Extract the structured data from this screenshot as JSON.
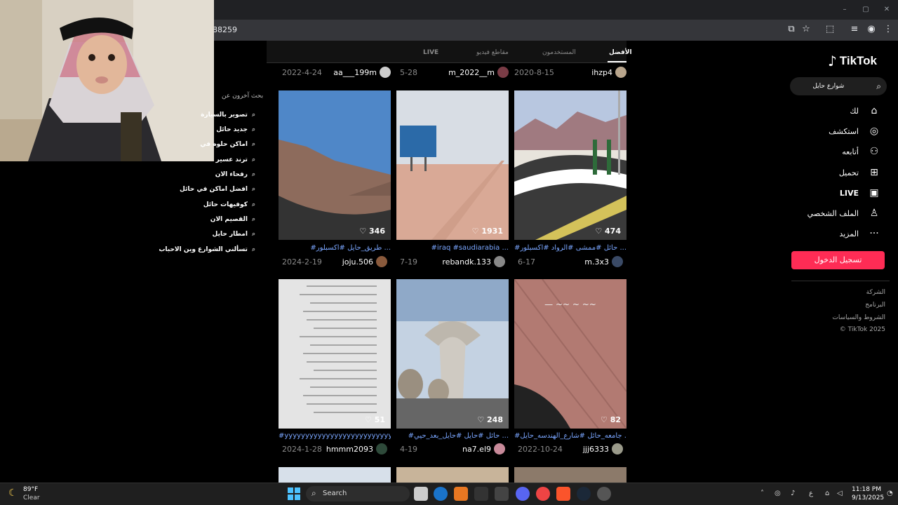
{
  "browser": {
    "url": "488259",
    "window_controls": {
      "minimize": "–",
      "maximize": "▢",
      "close": "✕"
    }
  },
  "tiktok": {
    "logo": "TikTok",
    "search": {
      "value": "شوارع حايل"
    },
    "nav": [
      {
        "label": "لك",
        "icon": "home-icon"
      },
      {
        "label": "استكشف",
        "icon": "compass-icon"
      },
      {
        "label": "أتابعه",
        "icon": "following-icon"
      },
      {
        "label": "تحميل",
        "icon": "upload-icon"
      },
      {
        "label": "LIVE",
        "icon": "live-icon"
      },
      {
        "label": "الملف الشخصي",
        "icon": "profile-icon"
      },
      {
        "label": "المزيد",
        "icon": "more-icon"
      }
    ],
    "login_button": "تسجيل الدخول",
    "footer": [
      "الشركة",
      "البرنامج",
      "الشروط والسياسات",
      "© TikTok 2025"
    ],
    "tabs": {
      "top": "الأفضل",
      "users": "المستخدمون",
      "videos": "مقاطع فيديو",
      "live": "LIVE"
    },
    "top_row": [
      {
        "user": "ihzp4",
        "date": "2020-8-15"
      },
      {
        "user": "m_2022__m",
        "date": "5-28"
      },
      {
        "user": "aa___199m",
        "date": "2022-4-24"
      }
    ],
    "videos": [
      {
        "views": "474",
        "caption": "#حائل #ممشى #الرواد #اكسبلور ...",
        "user": "m.3x3",
        "date": "6-17"
      },
      {
        "views": "1931",
        "caption": "#iraq #saudiarabia ...",
        "user": "rebandk.133",
        "date": "7-19"
      },
      {
        "views": "346",
        "caption": "#طريق_حايل #اكسبلور ...",
        "user": "joju.506",
        "date": "2024-2-19"
      },
      {
        "views": "82",
        "caption": "#جامعه_حائل #شارع_الهندسه_حايل ...",
        "user": "jjj6333",
        "date": "2022-10-24"
      },
      {
        "views": "248",
        "caption": "#حائل #حايل #حايل_بعد_حيي ...",
        "user": "na7.el9",
        "date": "4-19"
      },
      {
        "views": "51",
        "caption": "#yyyyyyyyyyyyyyyyyyyyyyyyyy",
        "user": "hmmm2093",
        "date": "2024-1-28"
      }
    ],
    "related": {
      "title": "بحث آخرون عن",
      "items": [
        "تصوير بالسيارة",
        "جديد حائل",
        "اماكن حلوه في",
        "ترند عسير",
        "رفحاء الان",
        "افضل اماكن في حائل",
        "كوفيهات حائل",
        "القصيم الان",
        "امطار حايل",
        "تسألني الشوارع وين الاحباب"
      ]
    }
  },
  "taskbar": {
    "weather_temp": "89°F",
    "weather_desc": "Clear",
    "search_placeholder": "Search",
    "time": "11:18 PM",
    "date": "9/13/2025",
    "lang": "ع"
  }
}
